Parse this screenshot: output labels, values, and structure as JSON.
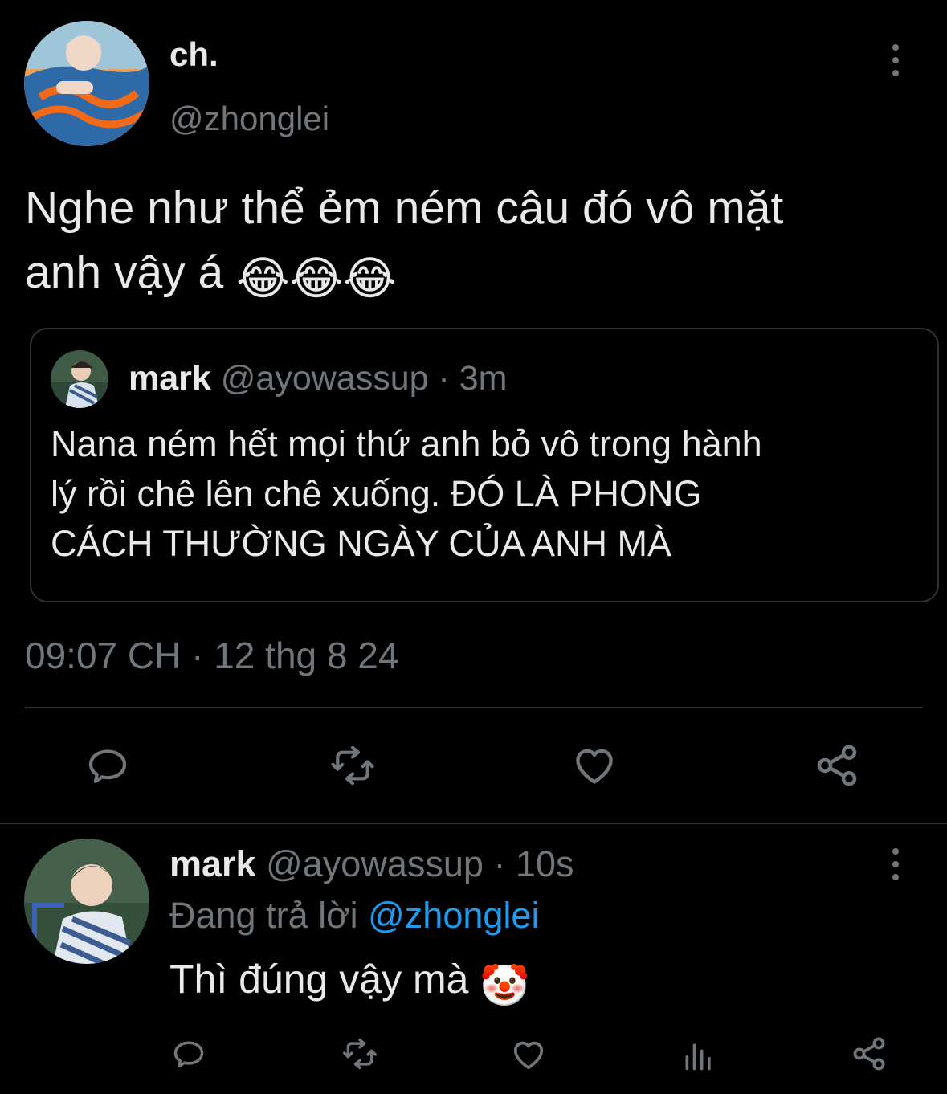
{
  "tweet": {
    "display_name": "ch.",
    "handle": "@zhonglei",
    "text": "Nghe như thể ẻm ném câu đó vô mặt",
    "text_line2": "anh vậy á",
    "emojis": [
      "😂",
      "😂",
      "😂"
    ],
    "quote": {
      "display_name": "mark",
      "handle": "@ayowassup",
      "time": "· 3m",
      "lines": [
        "Nana ném hết mọi thứ anh bỏ vô trong hành",
        "lý rồi chê lên chê xuống. ĐÓ LÀ PHONG",
        "CÁCH THƯỜNG NGÀY CỦA ANH MÀ"
      ]
    },
    "timestamp": "09:07 CH · 12 thg 8 24",
    "actions": {
      "reply": "reply-icon",
      "retweet": "retweet-icon",
      "like": "heart-icon",
      "share": "share-icon"
    }
  },
  "reply": {
    "display_name": "mark",
    "handle": "@ayowassup",
    "time": "· 10s",
    "replying_prefix": "Đang trả lời",
    "replying_to": "@zhonglei",
    "text": "Thì đúng vậy mà",
    "emoji": "🤡",
    "actions": [
      "reply-icon",
      "retweet-icon",
      "heart-icon",
      "analytics-icon",
      "share-icon"
    ]
  },
  "colors": {
    "background": "#000000",
    "text": "#e7e9ea",
    "muted": "#71767b",
    "link": "#1d9bf0",
    "border": "#2f3336"
  }
}
